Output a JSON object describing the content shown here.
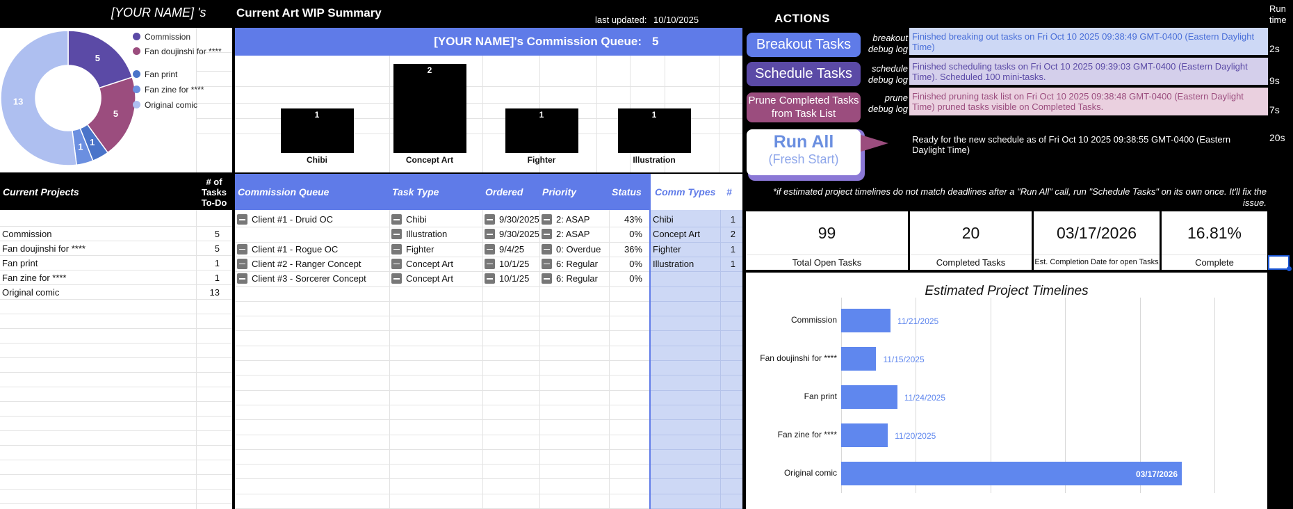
{
  "header": {
    "name": "[YOUR NAME] 's",
    "title": "Current Art WIP Summary",
    "last_updated_label": "last updated:",
    "last_updated_value": "10/10/2025",
    "actions_title": "ACTIONS",
    "run_time_title": "Run time"
  },
  "colors": {
    "accent": "#5f7be8",
    "commission": "#5b4aa6",
    "fan_doujinshi": "#9b4d7e",
    "fan_print": "#4a74c9",
    "fan_zine": "#6b8fe0",
    "original_comic": "#aebff0",
    "light_blue_col": "#cdd8f5"
  },
  "donut": {
    "legend": [
      {
        "label": "Commission",
        "color": "#5b4aa6"
      },
      {
        "label": "Fan doujinshi for ****",
        "color": "#9b4d7e"
      },
      {
        "label": "Fan print",
        "color": "#4a74c9"
      },
      {
        "label": "Fan zine for ****",
        "color": "#6b8fe0"
      },
      {
        "label": "Original comic",
        "color": "#aebff0"
      }
    ],
    "slice_labels": [
      "5",
      "5",
      "1",
      "1",
      "13"
    ]
  },
  "chart_data": [
    {
      "type": "pie",
      "categories": [
        "Commission",
        "Fan doujinshi for ****",
        "Fan print",
        "Fan zine for ****",
        "Original comic"
      ],
      "values": [
        5,
        5,
        1,
        1,
        13
      ],
      "title": "",
      "donut": true
    },
    {
      "type": "bar",
      "title": "",
      "categories": [
        "Chibi",
        "Concept Art",
        "Fighter",
        "Illustration"
      ],
      "values": [
        1,
        2,
        1,
        1
      ],
      "value_labels": [
        "1",
        "2",
        "1",
        "1"
      ],
      "ylim": [
        0,
        2
      ]
    },
    {
      "type": "bar",
      "orientation": "horizontal",
      "title": "Estimated Project Timelines",
      "categories": [
        "Commission",
        "Fan doujinshi for ****",
        "Fan print",
        "Fan zine for ****",
        "Original comic"
      ],
      "values": [
        "11/21/2025",
        "11/15/2025",
        "11/24/2025",
        "11/20/2025",
        "03/17/2026"
      ],
      "value_labels": [
        "11/21/2025",
        "11/15/2025",
        "11/24/2025",
        "11/20/2025",
        "03/17/2026"
      ],
      "fill": [
        0.145,
        0.103,
        0.165,
        0.137,
        1.0
      ],
      "gridlines": true
    }
  ],
  "queue_header": {
    "label": "[YOUR NAME]'s Commission Queue:",
    "count": "5"
  },
  "projects": {
    "headers": [
      "Current Projects",
      "# of Tasks To-Do"
    ],
    "rows": [
      {
        "name": "Commission",
        "count": "5"
      },
      {
        "name": "Fan doujinshi for ****",
        "count": "5"
      },
      {
        "name": "Fan print",
        "count": "1"
      },
      {
        "name": "Fan zine for ****",
        "count": "1"
      },
      {
        "name": "Original comic",
        "count": "13"
      }
    ]
  },
  "queue": {
    "headers": [
      "Commission Queue",
      "Task Type",
      "Ordered",
      "Priority",
      "Status"
    ],
    "rows": [
      {
        "client": "Client #1 - Druid OC",
        "task": "Chibi",
        "ordered": "9/30/2025",
        "priority": "2: ASAP",
        "status": "43%",
        "client_minus": true
      },
      {
        "client": "",
        "task": "Illustration",
        "ordered": "9/30/2025",
        "priority": "2: ASAP",
        "status": "0%",
        "client_minus": false
      },
      {
        "client": "Client #1 - Rogue OC",
        "task": "Fighter",
        "ordered": "9/4/25",
        "priority": "0: Overdue",
        "status": "36%",
        "client_minus": true
      },
      {
        "client": "Client #2 - Ranger Concept",
        "task": "Concept Art",
        "ordered": "10/1/25",
        "priority": "6: Regular",
        "status": "0%",
        "client_minus": true
      },
      {
        "client": "Client #3 - Sorcerer Concept",
        "task": "Concept Art",
        "ordered": "10/1/25",
        "priority": "6: Regular",
        "status": "0%",
        "client_minus": true
      }
    ]
  },
  "comm_types": {
    "headers": [
      "Comm Types",
      "#"
    ],
    "rows": [
      {
        "type": "Chibi",
        "count": "1"
      },
      {
        "type": "Concept Art",
        "count": "2"
      },
      {
        "type": "Fighter",
        "count": "1"
      },
      {
        "type": "Illustration",
        "count": "1"
      }
    ]
  },
  "actions": {
    "breakout": {
      "label": "Breakout Tasks",
      "debug": "breakout debug log",
      "log": "Finished breaking out tasks on Fri Oct 10 2025 09:38:49 GMT-0400 (Eastern Daylight Time)",
      "runtime": "2s"
    },
    "schedule": {
      "label": "Schedule Tasks",
      "debug": "schedule debug log",
      "log": "Finished scheduling tasks on Fri Oct 10 2025 09:39:03 GMT-0400 (Eastern Daylight Time). Scheduled 100 mini-tasks.",
      "runtime": "9s"
    },
    "prune": {
      "label": "Prune Completed Tasks from Task List",
      "debug": "prune debug log",
      "log": "Finished pruning task list on Fri Oct 10 2025 09:38:48 GMT-0400 (Eastern Daylight Time) pruned tasks visible on Completed Tasks.",
      "runtime": "7s"
    },
    "run_all": {
      "label": "Run All",
      "sublabel": "(Fresh Start)",
      "log": "Ready for the new schedule as of Fri Oct 10 2025 09:38:55 GMT-0400 (Eastern Daylight Time)",
      "runtime": "20s"
    },
    "note": "*if estimated project timelines do not match deadlines after a \"Run All\" call, run \"Schedule Tasks\" on its own once. It'll fix the issue."
  },
  "stats": [
    {
      "value": "99",
      "label": "Total Open Tasks"
    },
    {
      "value": "20",
      "label": "Completed Tasks"
    },
    {
      "value": "03/17/2026",
      "label": "Est. Completion Date for open Tasks"
    },
    {
      "value": "16.81%",
      "label": "Complete"
    }
  ]
}
